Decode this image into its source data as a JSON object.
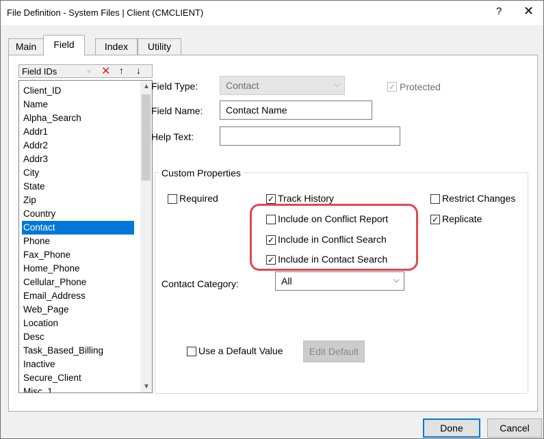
{
  "window": {
    "title": "File Definition - System Files | Client (CMCLIENT)",
    "help_label": "?",
    "close_label": "✕"
  },
  "tabs": [
    {
      "label": "Main"
    },
    {
      "label": "Field"
    },
    {
      "label": "Index"
    },
    {
      "label": "Utility"
    }
  ],
  "active_tab": "Field",
  "field_ids": {
    "header": "Field IDs",
    "toolbar_icons": [
      "new-field-icon",
      "delete-field-icon",
      "move-up-icon",
      "move-down-icon"
    ],
    "items": [
      "Client_ID",
      "Name",
      "Alpha_Search",
      "Addr1",
      "Addr2",
      "Addr3",
      "City",
      "State",
      "Zip",
      "Country",
      "Contact",
      "Phone",
      "Fax_Phone",
      "Home_Phone",
      "Cellular_Phone",
      "Email_Address",
      "Web_Page",
      "Location",
      "Desc",
      "Task_Based_Billing",
      "Inactive",
      "Secure_Client",
      "Misc_1"
    ],
    "selected": "Contact"
  },
  "form": {
    "field_type_label": "Field Type:",
    "field_type_value": "Contact",
    "protected_label": "Protected",
    "protected_checked": true,
    "field_name_label": "Field Name:",
    "field_name_value": "Contact Name",
    "help_text_label": "Help Text:",
    "help_text_value": ""
  },
  "custom_properties": {
    "title": "Custom Properties",
    "required": {
      "label": "Required",
      "checked": false
    },
    "track_history": {
      "label": "Track History",
      "checked": true
    },
    "restrict_changes": {
      "label": "Restrict Changes",
      "checked": false
    },
    "include_conflict_report": {
      "label": "Include on Conflict Report",
      "checked": false
    },
    "replicate": {
      "label": "Replicate",
      "checked": true
    },
    "include_conflict_search": {
      "label": "Include in Conflict Search",
      "checked": true
    },
    "include_contact_search": {
      "label": "Include in Contact Search",
      "checked": true
    },
    "contact_category_label": "Contact Category:",
    "contact_category_value": "All",
    "use_default": {
      "label": "Use a Default Value",
      "checked": false
    },
    "edit_default_label": "Edit Default"
  },
  "footer": {
    "done_label": "Done",
    "cancel_label": "Cancel"
  },
  "colors": {
    "selection": "#0078d7",
    "highlight_border": "#e5454e"
  }
}
